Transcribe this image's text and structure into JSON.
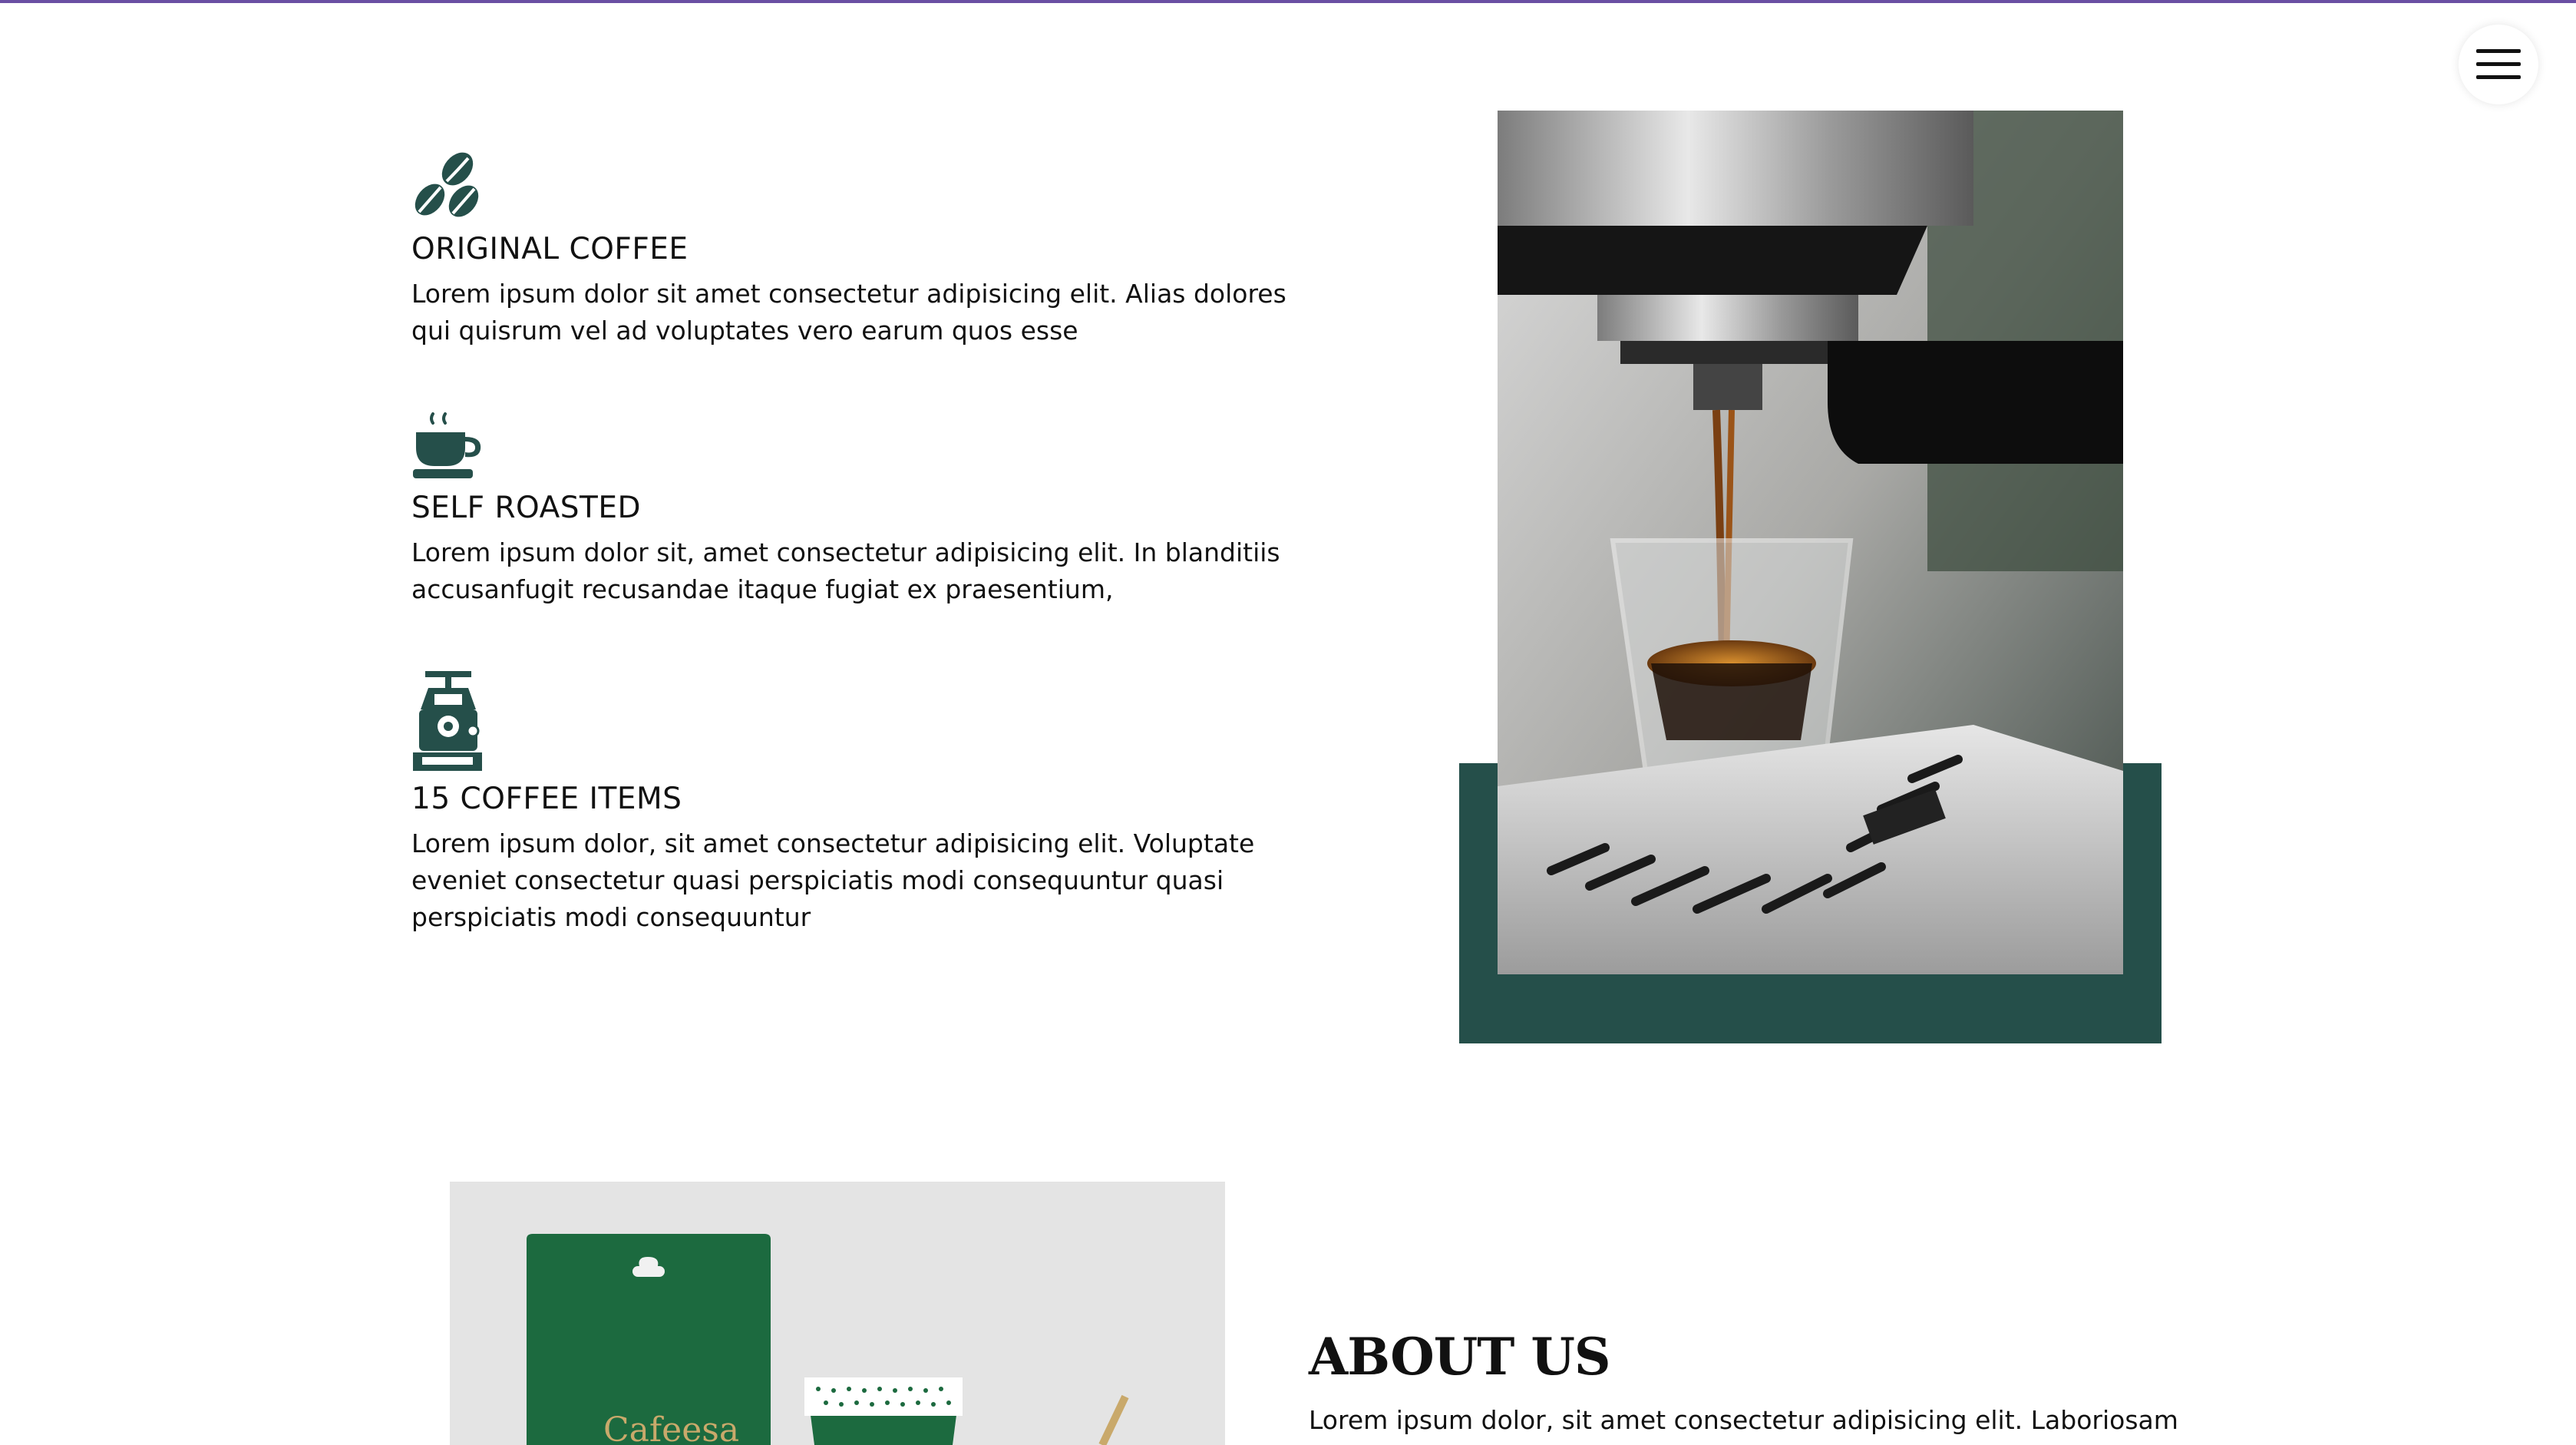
{
  "colors": {
    "accent": "#254f4a",
    "top_bar": "#6a4fa3"
  },
  "nav": {
    "menu_icon": "hamburger-menu-icon"
  },
  "features": [
    {
      "icon": "coffee-beans-icon",
      "title": "ORIGINAL COFFEE",
      "description": "Lorem ipsum dolor sit amet consectetur adipisicing elit. Alias dolores qui quisrum vel ad voluptates vero earum quos esse"
    },
    {
      "icon": "coffee-cup-icon",
      "title": "SELF ROASTED",
      "description": "Lorem ipsum dolor sit, amet consectetur adipisicing elit. In blanditiis accusanfugit recusandae itaque fugiat ex praesentium,"
    },
    {
      "icon": "coffee-grinder-icon",
      "title": "15 COFFEE ITEMS",
      "description": "Lorem ipsum dolor, sit amet consectetur adipisicing elit. Voluptate eveniet consectetur quasi perspiciatis modi consequuntur quasi perspiciatis modi consequuntur"
    }
  ],
  "about": {
    "title": "ABOUT US",
    "text": "Lorem ipsum dolor, sit amet consectetur adipisicing elit. Laboriosam",
    "bag_brand": "Cafeesa"
  }
}
